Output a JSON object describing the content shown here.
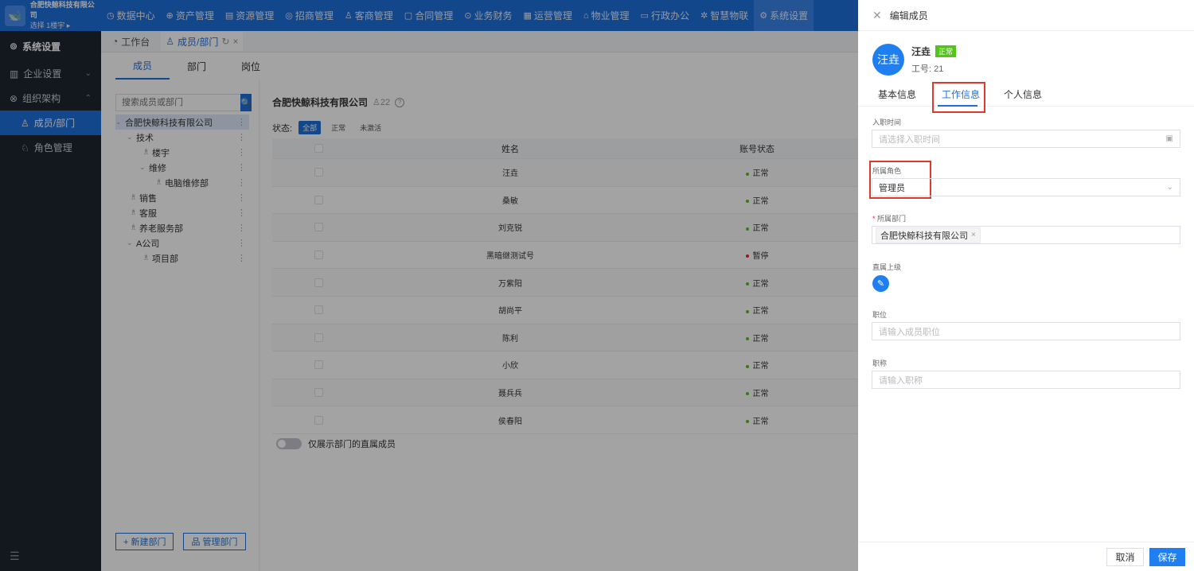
{
  "brand": {
    "company": "合肥快鲸科技有限公司",
    "sub": "选择 1楼宇 ▸"
  },
  "nav": [
    {
      "icon": "◷",
      "label": "数据中心"
    },
    {
      "icon": "⊕",
      "label": "资产管理"
    },
    {
      "icon": "▤",
      "label": "资源管理"
    },
    {
      "icon": "◎",
      "label": "招商管理"
    },
    {
      "icon": "♙",
      "label": "客商管理"
    },
    {
      "icon": "▢",
      "label": "合同管理"
    },
    {
      "icon": "⊙",
      "label": "业务财务"
    },
    {
      "icon": "▦",
      "label": "运营管理"
    },
    {
      "icon": "⌂",
      "label": "物业管理"
    },
    {
      "icon": "▭",
      "label": "行政办公"
    },
    {
      "icon": "✲",
      "label": "智慧物联"
    },
    {
      "icon": "⚙",
      "label": "系统设置"
    }
  ],
  "sidebar": {
    "header": "系统设置",
    "items": [
      {
        "label": "企业设置",
        "chevron": "⌄"
      },
      {
        "label": "组织架构",
        "chevron": "⌃"
      },
      {
        "label": "成员/部门"
      },
      {
        "label": "角色管理"
      }
    ]
  },
  "page_tabs": [
    {
      "label": "工作台"
    },
    {
      "label": "成员/部门",
      "refresh": "↻",
      "close": "×"
    }
  ],
  "subtabs": [
    "成员",
    "部门",
    "岗位"
  ],
  "search": {
    "placeholder": "搜索成员或部门",
    "btn": "🔍"
  },
  "tree": [
    {
      "label": "合肥快鲸科技有限公司",
      "level": 0,
      "toggle": "⌄",
      "selected": true
    },
    {
      "label": "技术",
      "level": 1,
      "toggle": "⌄"
    },
    {
      "label": "楼宇",
      "level": 2
    },
    {
      "label": "维修",
      "level": 2,
      "toggle": "⌄"
    },
    {
      "label": "电脑维修部",
      "level": 3
    },
    {
      "label": "销售",
      "level": 1
    },
    {
      "label": "客服",
      "level": 1
    },
    {
      "label": "养老服务部",
      "level": 1
    },
    {
      "label": "A公司",
      "level": 1,
      "toggle": "⌄"
    },
    {
      "label": "项目部",
      "level": 2
    }
  ],
  "tree_buttons": {
    "new_dept": "+ 新建部门",
    "manage_dept": "品 管理部门"
  },
  "org": {
    "name": "合肥快鲸科技有限公司",
    "count": "♙22",
    "help": "?"
  },
  "status_filter": {
    "label": "状态:",
    "options": [
      "全部",
      "正常",
      "未激活"
    ]
  },
  "table": {
    "headers": {
      "name": "姓名",
      "status": "账号状态"
    },
    "rows": [
      {
        "name": "汪垚",
        "status": "正常"
      },
      {
        "name": "桑敏",
        "status": "正常"
      },
      {
        "name": "刘克锐",
        "status": "正常"
      },
      {
        "name": "黑暗继测试号",
        "status": "暂停"
      },
      {
        "name": "万紫阳",
        "status": "正常"
      },
      {
        "name": "胡尚平",
        "status": "正常"
      },
      {
        "name": "陈利",
        "status": "正常"
      },
      {
        "name": "小欣",
        "status": "正常"
      },
      {
        "name": "聂兵兵",
        "status": "正常"
      },
      {
        "name": "侯春阳",
        "status": "正常"
      }
    ]
  },
  "toggle_label": "仅展示部门的直属成员",
  "drawer": {
    "title": "编辑成员",
    "avatar": "汪垚",
    "name": "汪垚",
    "badge": "正常",
    "emp_no": "工号: 21",
    "tabs": [
      "基本信息",
      "工作信息",
      "个人信息"
    ],
    "fields": {
      "join_label": "入职时间",
      "join_placeholder": "请选择入职时间",
      "role_label": "所属角色",
      "role_value": "管理员",
      "dept_label": "所属部门",
      "dept_required": "*",
      "dept_tag": "合肥快鲸科技有限公司",
      "superior_label": "直属上级",
      "position_label": "职位",
      "position_placeholder": "请输入成员职位",
      "title_label": "职称",
      "title_placeholder": "请输入职称"
    },
    "cancel": "取消",
    "save": "保存"
  },
  "colors": {
    "primary": "#1f6fd9",
    "success": "#52c41a",
    "danger": "#f5222d",
    "highlight": "#e2382b"
  }
}
